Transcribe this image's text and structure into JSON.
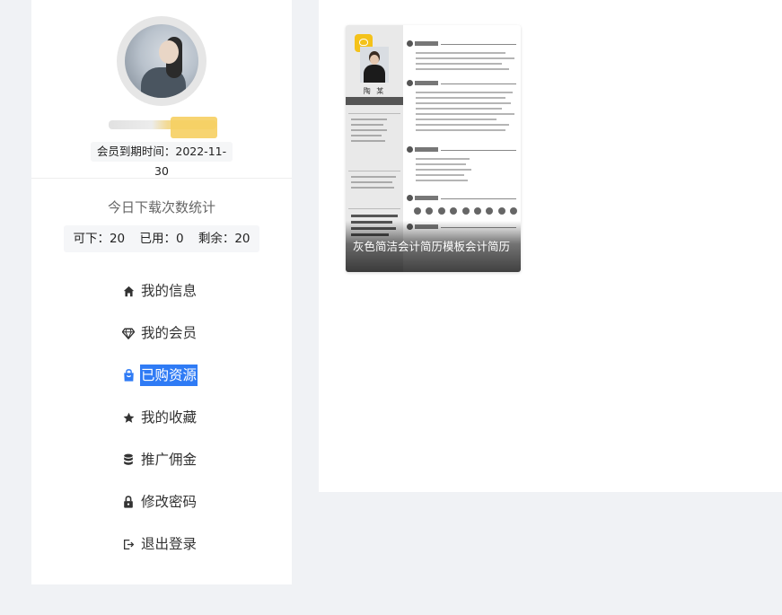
{
  "profile": {
    "username": "",
    "expire_label": "会员到期时间：2022-11-30"
  },
  "stats": {
    "title": "今日下载次数统计",
    "available": "可下：20",
    "used": "已用：0",
    "remaining": "剩余：20"
  },
  "menu": [
    {
      "label": "我的信息",
      "icon": "home-icon",
      "active": false
    },
    {
      "label": "我的会员",
      "icon": "diamond-icon",
      "active": false
    },
    {
      "label": "已购资源",
      "icon": "shopping-bag-icon",
      "active": true
    },
    {
      "label": "我的收藏",
      "icon": "star-icon",
      "active": false
    },
    {
      "label": "推广佣金",
      "icon": "database-icon",
      "active": false
    },
    {
      "label": "修改密码",
      "icon": "lock-icon",
      "active": false
    },
    {
      "label": "退出登录",
      "icon": "logout-icon",
      "active": false
    }
  ],
  "resources": [
    {
      "title": "灰色简洁会计简历模板会计简历",
      "resume_name": "陶 某"
    }
  ],
  "colors": {
    "accent": "#2f7bf5",
    "vip_gold": "#f6cf62",
    "page_bg": "#f0f2f5"
  }
}
